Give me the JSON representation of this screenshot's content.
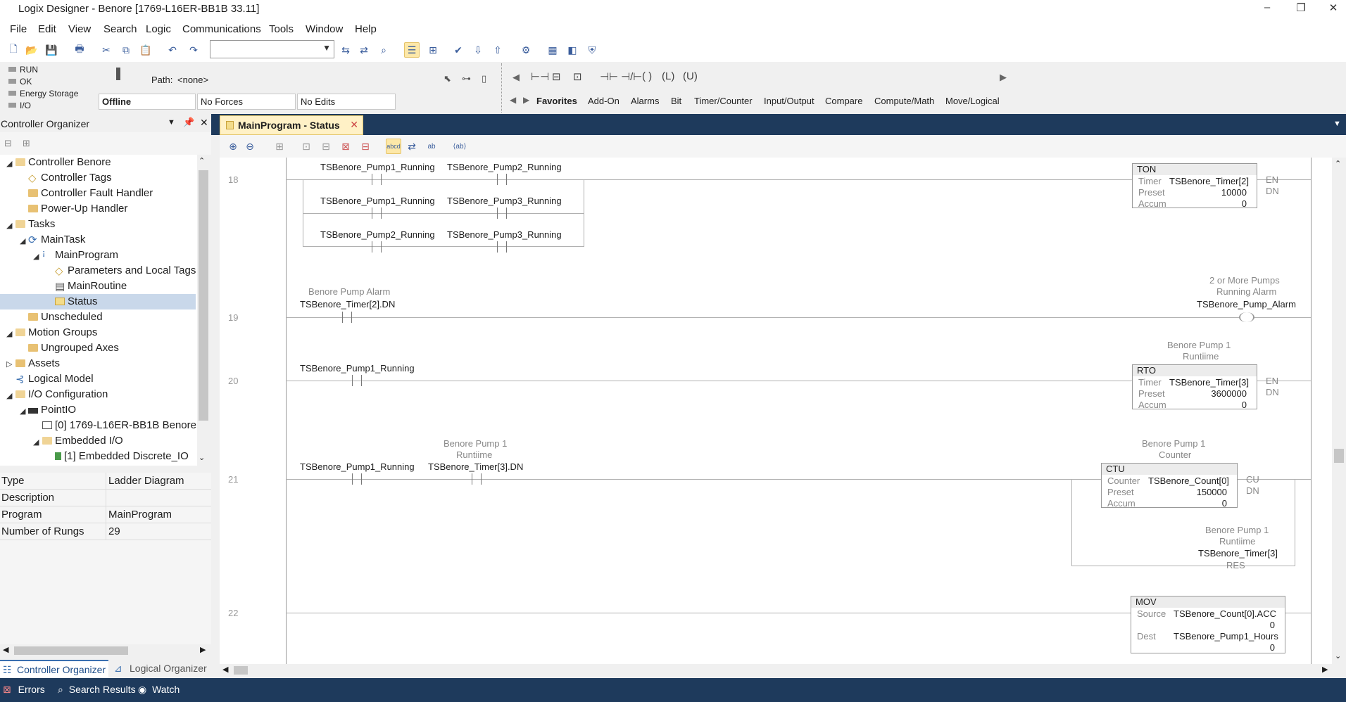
{
  "window": {
    "title": "Logix Designer - Benore [1769-L16ER-BB1B 33.11]"
  },
  "menu": [
    "File",
    "Edit",
    "View",
    "Search",
    "Logic",
    "Communications",
    "Tools",
    "Window",
    "Help"
  ],
  "status": {
    "indicators": [
      "RUN",
      "OK",
      "Energy Storage",
      "I/O"
    ],
    "path_label": "Path:",
    "path_value": "<none>",
    "mode": "Offline",
    "forces": "No Forces",
    "edits": "No Edits"
  },
  "instruction_tabs": [
    "Favorites",
    "Add-On",
    "Alarms",
    "Bit",
    "Timer/Counter",
    "Input/Output",
    "Compare",
    "Compute/Math",
    "Move/Logical"
  ],
  "organizer": {
    "title": "Controller Organizer",
    "tree": [
      {
        "label": "Controller Benore"
      },
      {
        "label": "Controller Tags"
      },
      {
        "label": "Controller Fault Handler"
      },
      {
        "label": "Power-Up Handler"
      },
      {
        "label": "Tasks"
      },
      {
        "label": "MainTask"
      },
      {
        "label": "MainProgram"
      },
      {
        "label": "Parameters and Local Tags"
      },
      {
        "label": "MainRoutine"
      },
      {
        "label": "Status"
      },
      {
        "label": "Unscheduled"
      },
      {
        "label": "Motion Groups"
      },
      {
        "label": "Ungrouped Axes"
      },
      {
        "label": "Assets"
      },
      {
        "label": "Logical Model"
      },
      {
        "label": "I/O Configuration"
      },
      {
        "label": "PointIO"
      },
      {
        "label": "[0] 1769-L16ER-BB1B Benore"
      },
      {
        "label": "Embedded I/O"
      },
      {
        "label": "[1] Embedded Discrete_IO"
      }
    ],
    "properties": [
      {
        "k": "Type",
        "v": "Ladder Diagram"
      },
      {
        "k": "Description",
        "v": ""
      },
      {
        "k": "Program",
        "v": "MainProgram"
      },
      {
        "k": "Number of Rungs",
        "v": "29"
      }
    ],
    "bottom_tabs": [
      "Controller Organizer",
      "Logical Organizer"
    ]
  },
  "editor": {
    "tab_title": "MainProgram - Status",
    "rungs": [
      {
        "num": "18"
      },
      {
        "num": "19"
      },
      {
        "num": "20"
      },
      {
        "num": "21"
      },
      {
        "num": "22"
      }
    ],
    "labels": {
      "p1r": "TSBenore_Pump1_Running",
      "p2r": "TSBenore_Pump2_Running",
      "p3r": "TSBenore_Pump3_Running",
      "ton": "TON",
      "timer": "Timer",
      "preset": "Preset",
      "accum": "Accum",
      "timer2": "TSBenore_Timer[2]",
      "preset1": "10000",
      "zero": "0",
      "en": "EN",
      "dn": "DN",
      "alarm_desc": "Benore Pump Alarm",
      "timer2dn": "TSBenore_Timer[2].DN",
      "more_pumps1": "2 or More Pumps",
      "more_pumps2": "Running Alarm",
      "pump_alarm": "TSBenore_Pump_Alarm",
      "bp1_1": "Benore Pump 1",
      "runtime": "Runtiime",
      "rto": "RTO",
      "timer3": "TSBenore_Timer[3]",
      "preset2": "3600000",
      "timer3dn": "TSBenore_Timer[3].DN",
      "counter_desc": "Counter",
      "ctu": "CTU",
      "counter": "Counter",
      "count0": "TSBenore_Count[0]",
      "preset3": "150000",
      "cu": "CU",
      "res": "RES",
      "mov": "MOV",
      "source": "Source",
      "src_val": "TSBenore_Count[0].ACC",
      "dest": "Dest",
      "dest_val": "TSBenore_Pump1_Hours"
    }
  },
  "statusbar": [
    "Errors",
    "Search Results",
    "Watch"
  ]
}
